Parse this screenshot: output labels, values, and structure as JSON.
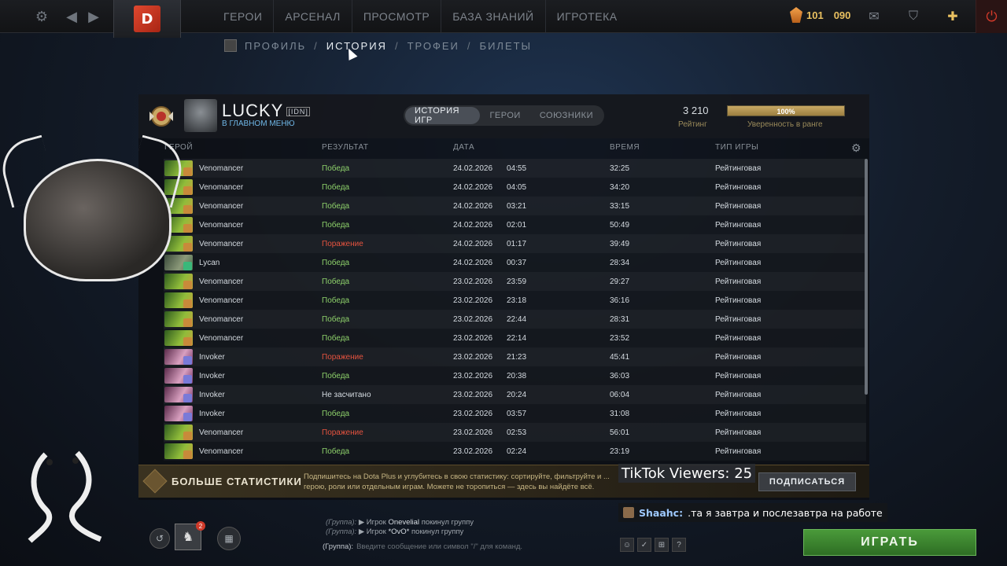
{
  "topbar": {
    "nav": [
      "ГЕРОИ",
      "АРСЕНАЛ",
      "ПРОСМОТР",
      "БАЗА ЗНАНИЙ",
      "ИГРОТЕКА"
    ],
    "currency_shards": "101",
    "currency_level": "090"
  },
  "breadcrumb": {
    "items": [
      "ПРОФИЛЬ",
      "ИСТОРИЯ",
      "ТРОФЕИ",
      "БИЛЕТЫ"
    ],
    "separator": "/"
  },
  "profile": {
    "name": "LUCKY",
    "tag": "[IDN]",
    "status": "В ГЛАВНОМ МЕНЮ",
    "rating": "3 210",
    "rating_label": "Рейтинг",
    "confidence": "100%",
    "confidence_fraction": 1.0,
    "confidence_label": "Уверенность в ранге"
  },
  "tabs": [
    "ИСТОРИЯ ИГР",
    "ГЕРОИ",
    "СОЮЗНИКИ"
  ],
  "columns": {
    "hero": "ГЕРОЙ",
    "result": "РЕЗУЛЬТАТ",
    "date": "ДАТА",
    "duration": "ВРЕМЯ",
    "type": "ТИП ИГРЫ"
  },
  "matches": [
    {
      "hero": "Venomancer",
      "result": "Победа",
      "date": "24.02.2026",
      "time": "04:55",
      "duration": "32:25",
      "type": "Рейтинговая"
    },
    {
      "hero": "Venomancer",
      "result": "Победа",
      "date": "24.02.2026",
      "time": "04:05",
      "duration": "34:20",
      "type": "Рейтинговая"
    },
    {
      "hero": "Venomancer",
      "result": "Победа",
      "date": "24.02.2026",
      "time": "03:21",
      "duration": "33:15",
      "type": "Рейтинговая"
    },
    {
      "hero": "Venomancer",
      "result": "Победа",
      "date": "24.02.2026",
      "time": "02:01",
      "duration": "50:49",
      "type": "Рейтинговая"
    },
    {
      "hero": "Venomancer",
      "result": "Поражение",
      "date": "24.02.2026",
      "time": "01:17",
      "duration": "39:49",
      "type": "Рейтинговая"
    },
    {
      "hero": "Lycan",
      "result": "Победа",
      "date": "24.02.2026",
      "time": "00:37",
      "duration": "28:34",
      "type": "Рейтинговая"
    },
    {
      "hero": "Venomancer",
      "result": "Победа",
      "date": "23.02.2026",
      "time": "23:59",
      "duration": "29:27",
      "type": "Рейтинговая"
    },
    {
      "hero": "Venomancer",
      "result": "Победа",
      "date": "23.02.2026",
      "time": "23:18",
      "duration": "36:16",
      "type": "Рейтинговая"
    },
    {
      "hero": "Venomancer",
      "result": "Победа",
      "date": "23.02.2026",
      "time": "22:44",
      "duration": "28:31",
      "type": "Рейтинговая"
    },
    {
      "hero": "Venomancer",
      "result": "Победа",
      "date": "23.02.2026",
      "time": "22:14",
      "duration": "23:52",
      "type": "Рейтинговая"
    },
    {
      "hero": "Invoker",
      "result": "Поражение",
      "date": "23.02.2026",
      "time": "21:23",
      "duration": "45:41",
      "type": "Рейтинговая"
    },
    {
      "hero": "Invoker",
      "result": "Победа",
      "date": "23.02.2026",
      "time": "20:38",
      "duration": "36:03",
      "type": "Рейтинговая"
    },
    {
      "hero": "Invoker",
      "result": "Не засчитано",
      "date": "23.02.2026",
      "time": "20:24",
      "duration": "06:04",
      "type": "Рейтинговая"
    },
    {
      "hero": "Invoker",
      "result": "Победа",
      "date": "23.02.2026",
      "time": "03:57",
      "duration": "31:08",
      "type": "Рейтинговая"
    },
    {
      "hero": "Venomancer",
      "result": "Поражение",
      "date": "23.02.2026",
      "time": "02:53",
      "duration": "56:01",
      "type": "Рейтинговая"
    },
    {
      "hero": "Venomancer",
      "result": "Победа",
      "date": "23.02.2026",
      "time": "02:24",
      "duration": "23:19",
      "type": "Рейтинговая"
    }
  ],
  "dota_plus": {
    "title": "БОЛЬШЕ СТАТИСТИКИ",
    "text": "Подпишитесь на Dota Plus и углубитесь в свою статистику: сортируйте, фильтруйте и ... герою, роли или отдельным играм. Можете не торопиться — здесь вы найдёте всё.",
    "button": "ПОДПИСАТЬСЯ"
  },
  "overlay": {
    "tiktok": "TikTok Viewers: 25",
    "chat_user": "Shaahc:",
    "chat_text": ".та я завтра и послезавтра на работе"
  },
  "group_chat": {
    "lines": [
      {
        "prefix": "(Группа):",
        "pre": "▶ Игрок",
        "name": "Onevelial",
        "post": "покинул группу"
      },
      {
        "prefix": "(Группа):",
        "pre": "▶ Игрок",
        "name": "*OvO*",
        "post": "покинул группу"
      }
    ],
    "input_prefix": "(Группа):",
    "input_placeholder": "Введите сообщение или символ \"/\" для команд."
  },
  "party": {
    "notification_count": "2"
  },
  "play_button": "ИГРАТЬ",
  "colors": {
    "win": "#8dd06a",
    "loss": "#e5533f",
    "accent_gold": "#c8a864",
    "play_green": "#4a9a3a"
  }
}
